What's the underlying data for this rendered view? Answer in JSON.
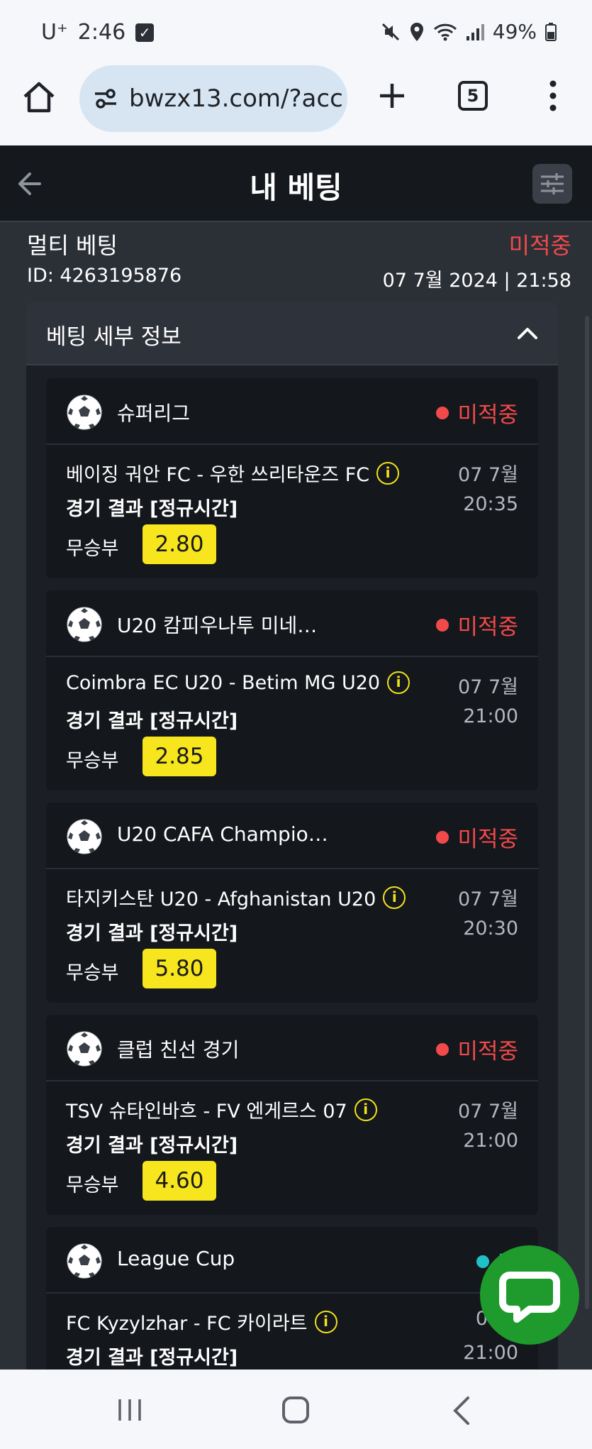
{
  "status_bar": {
    "carrier": "U⁺",
    "time": "2:46",
    "battery": "49%"
  },
  "browser": {
    "url": "bwzx13.com/?acc",
    "tab_count": "5"
  },
  "header": {
    "title": "내 베팅"
  },
  "bet": {
    "type": "멀티 베팅",
    "status": "미적중",
    "id": "ID: 4263195876",
    "date": "07 7월 2024 | 21:58"
  },
  "details": {
    "title": "베팅 세부 정보",
    "selections": [
      {
        "league": "슈퍼리그",
        "status": "미적중",
        "status_color": "#f24a4a",
        "match": "베이징 궈안 FC - 우한 쓰리타운즈 FC",
        "market": "경기 결과 [정규시간]",
        "pick": "무승부",
        "odds": "2.80",
        "date": "07 7월",
        "time": "20:35"
      },
      {
        "league": "U20 캄피우나투 미네…",
        "status": "미적중",
        "status_color": "#f24a4a",
        "match": "Coimbra EC U20 - Betim MG U20",
        "market": "경기 결과 [정규시간]",
        "pick": "무승부",
        "odds": "2.85",
        "date": "07 7월",
        "time": "21:00"
      },
      {
        "league": "U20 CAFA Champio…",
        "status": "미적중",
        "status_color": "#f24a4a",
        "match": "타지키스탄 U20 - Afghanistan U20",
        "market": "경기 결과 [정규시간]",
        "pick": "무승부",
        "odds": "5.80",
        "date": "07 7월",
        "time": "20:30"
      },
      {
        "league": "클럽 친선 경기",
        "status": "미적중",
        "status_color": "#f24a4a",
        "match": "TSV 슈타인바흐 - FV 엔게르스 07",
        "market": "경기 결과 [정규시간]",
        "pick": "무승부",
        "odds": "4.60",
        "date": "07 7월",
        "time": "21:00"
      },
      {
        "league": "League Cup",
        "status": "적",
        "status_color": "#1fc1c9",
        "match": "FC Kyzylzhar - FC 카이라트",
        "market": "경기 결과 [정규시간]",
        "pick": "",
        "odds": "",
        "date": "07 7",
        "time": "21:00"
      }
    ]
  }
}
